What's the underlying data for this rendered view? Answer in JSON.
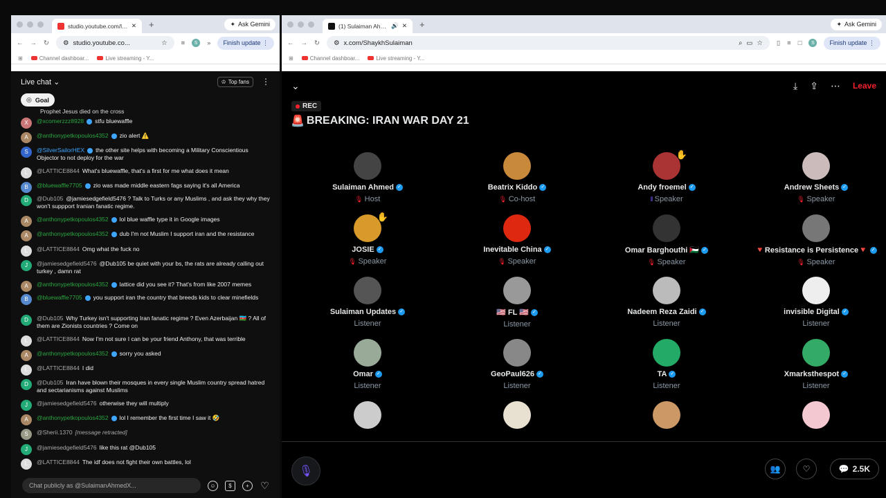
{
  "left": {
    "tab_title": "studio.youtube.com/live_chat",
    "ask_gemini": "Ask Gemini",
    "url": "studio.youtube.co...",
    "finish_update": "Finish update",
    "bookmarks": [
      "Channel dashboar...",
      "Live streaming - Y..."
    ],
    "chat_title": "Live chat",
    "top_fans": "Top fans",
    "goal": "Goal",
    "cut_text": "Prophet Jesus died on the cross",
    "input_placeholder": "Chat publicly as @SulaimanAhmedX...",
    "messages": [
      {
        "a": "@xcomerzzz8928",
        "c": "green",
        "t": "stfu bluewaffle",
        "av": "#c77"
      },
      {
        "a": "@anthonypetkopoulos4352",
        "c": "green",
        "t": "zio alert ⚠️",
        "av": "#a86"
      },
      {
        "a": "@SilverSailorHEX",
        "c": "blue",
        "t": "the other site helps with becoming a Military Conscientious Objector to not deploy for the war",
        "av": "#36c"
      },
      {
        "a": "@LATTICE8844",
        "c": "",
        "t": "What's bluewaffle, that's a first for me what does it mean",
        "av": "#ddd"
      },
      {
        "a": "@bluewaffle7705",
        "c": "green",
        "t": "zio was made middle eastern fags saying it's all America",
        "av": "#58c"
      },
      {
        "a": "@Dub105",
        "c": "",
        "t": "@jamiesedgefield5476 ? Talk to Turks or any Muslims , and ask they why they won't suppport Iranian fanatic regime.",
        "av": "#2a7"
      },
      {
        "a": "@anthonypetkopoulos4352",
        "c": "green",
        "t": "lol blue waffle type it in Google images",
        "av": "#a86"
      },
      {
        "a": "@anthonypetkopoulos4352",
        "c": "green",
        "t": "dub I'm not Muslim I support iran and the resistance",
        "av": "#a86"
      },
      {
        "a": "@LATTICE8844",
        "c": "",
        "t": "Omg what the fuck no",
        "av": "#ddd"
      },
      {
        "a": "@jamiesedgefield5476",
        "c": "",
        "t": "@Dub105 be quiet with your bs, the rats are already calling out turkey , damn rat",
        "av": "#2a7"
      },
      {
        "a": "@anthonypetkopoulos4352",
        "c": "green",
        "t": "lattice did you see it? That's from like 2007 memes",
        "av": "#a86"
      },
      {
        "a": "@bluewaffle7705",
        "c": "green",
        "t": "you support iran the country that breeds kids to clear minefields",
        "av": "#58c"
      },
      {
        "a": "@Dub105",
        "c": "",
        "t": "Why Turkey isn't supporting Iran fanatic regime ? Even Azerbaijan 🇦🇿 ? All of them are Zionists countries ? Come on",
        "av": "#2a7"
      },
      {
        "a": "@LATTICE8844",
        "c": "",
        "t": "Now I'm not sure I can be your friend Anthony, that was terrible",
        "av": "#ddd"
      },
      {
        "a": "@anthonypetkopoulos4352",
        "c": "green",
        "t": "sorry you asked",
        "av": "#a86"
      },
      {
        "a": "@LATTICE8844",
        "c": "",
        "t": "I did",
        "av": "#ddd"
      },
      {
        "a": "@Dub105",
        "c": "",
        "t": "Iran have blown their mosques in every single Muslim country spread hatred and sectarianisms against Muslims",
        "av": "#2a7"
      },
      {
        "a": "@jamiesedgefield5476",
        "c": "",
        "t": "otherwise they will multiply",
        "av": "#2a7"
      },
      {
        "a": "@anthonypetkopoulos4352",
        "c": "green",
        "t": "lol I remember the first time I saw it 🤣",
        "av": "#a86"
      },
      {
        "a": "@Sherii.1370",
        "c": "",
        "t": "[message retracted]",
        "av": "#998",
        "ret": true
      },
      {
        "a": "@jamiesedgefield5476",
        "c": "",
        "t": "like this rat @Dub105",
        "av": "#2a7"
      },
      {
        "a": "@LATTICE8844",
        "c": "",
        "t": "The idf does not fight their own battles, lol",
        "av": "#ddd"
      }
    ]
  },
  "right": {
    "tab_title": "(1) Sulaiman Ahmed (@ShaykhSulaiman)",
    "ask_gemini": "Ask Gemini",
    "url": "x.com/ShaykhSulaiman",
    "finish_update": "Finish update",
    "bookmarks": [
      "Channel dashboar...",
      "Live streaming - Y..."
    ],
    "leave": "Leave",
    "rec": "REC",
    "title": "BREAKING: IRAN WAR DAY 21",
    "count": "2.5K",
    "participants": [
      {
        "n": "Sulaiman Ahmed",
        "r": "Host",
        "c": "#444"
      },
      {
        "n": "Beatrix Kiddo",
        "r": "Co-host",
        "c": "#c8893a"
      },
      {
        "n": "Andy froemel",
        "r": "Speaker",
        "c": "#a33",
        "hand": true
      },
      {
        "n": "Andrew Sheets",
        "r": "Speaker",
        "c": "#cbb"
      },
      {
        "n": "JOSIE",
        "r": "Speaker",
        "c": "#d89a2a",
        "hand": true
      },
      {
        "n": "Inevitable China",
        "r": "Speaker",
        "c": "#de2910"
      },
      {
        "n": "Omar Barghouthi 🇵🇸",
        "r": "Speaker",
        "c": "#333"
      },
      {
        "n": "🔻Resistance is Persistence🔻",
        "r": "Speaker",
        "c": "#777"
      },
      {
        "n": "Sulaiman Updates",
        "r": "Listener",
        "c": "#555"
      },
      {
        "n": "🇺🇸 FL 🇺🇸",
        "r": "Listener",
        "c": "#999"
      },
      {
        "n": "Nadeem Reza Zaidi",
        "r": "Listener",
        "c": "#bbb"
      },
      {
        "n": "invisible Digital",
        "r": "Listener",
        "c": "#eee"
      },
      {
        "n": "Omar",
        "r": "Listener",
        "c": "#9a9"
      },
      {
        "n": "GeoPaul626",
        "r": "Listener",
        "c": "#888"
      },
      {
        "n": "TA",
        "r": "Listener",
        "c": "#2a6"
      },
      {
        "n": "Xmarksthespot",
        "r": "Listener",
        "c": "#3a6"
      },
      {
        "n": "",
        "r": "",
        "c": "#ccc"
      },
      {
        "n": "",
        "r": "",
        "c": "#e8e0d0"
      },
      {
        "n": "",
        "r": "",
        "c": "#c96"
      },
      {
        "n": "",
        "r": "",
        "c": "#f4c8d0"
      }
    ]
  }
}
